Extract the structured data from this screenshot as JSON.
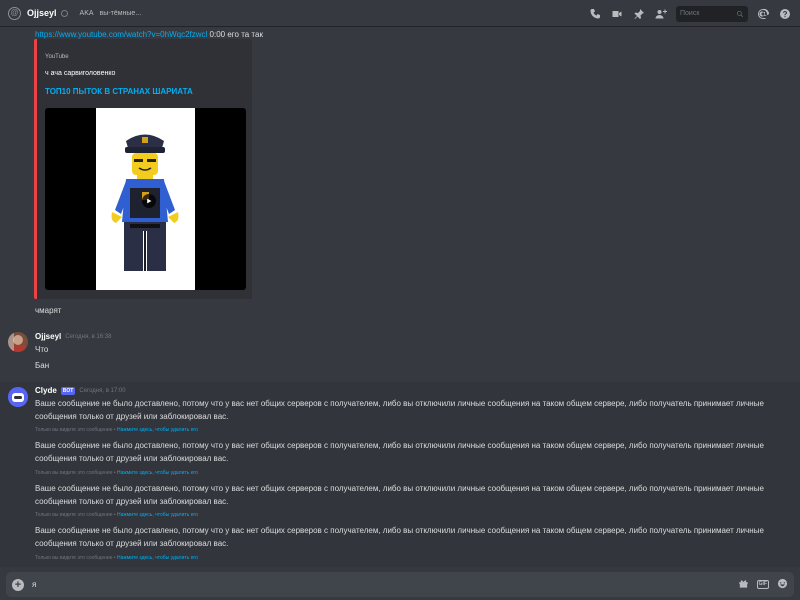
{
  "header": {
    "name": "Ojjseyl",
    "aka_label": "AKA",
    "nickname": "вы-тёмные...",
    "search_placeholder": "Поиск"
  },
  "messages": {
    "link": {
      "url": "https://www.youtube.com/watch?v=0hWqc2fzwcl",
      "tail": "0:00 его та так"
    },
    "embed": {
      "provider": "YouTube",
      "author": "ч ача сарвиголовенко",
      "title": "ТОП10 ПЫТОК В СТРАНАХ ШАРИАТА"
    },
    "followup": "чмарят",
    "ojjseyl": {
      "author": "Ojjseyl",
      "timestamp": "Сегодня, в 16:38",
      "lines": [
        "Что",
        "Бан"
      ]
    },
    "clyde": {
      "author": "Clyde",
      "bot_tag": "BOT",
      "timestamp": "Сегодня, в 17:00",
      "text": "Ваше сообщение не было доставлено, потому что у вас нет общих серверов с получателем, либо вы отключили личные сообщения на таком общем сервере, либо получатель принимает личные сообщения только от друзей или заблокировал вас.",
      "note_prefix": "Только вы видите это сообщение •",
      "note_link": "Нажмите здесь, чтобы удалить его"
    }
  },
  "composer": {
    "value": "я"
  }
}
